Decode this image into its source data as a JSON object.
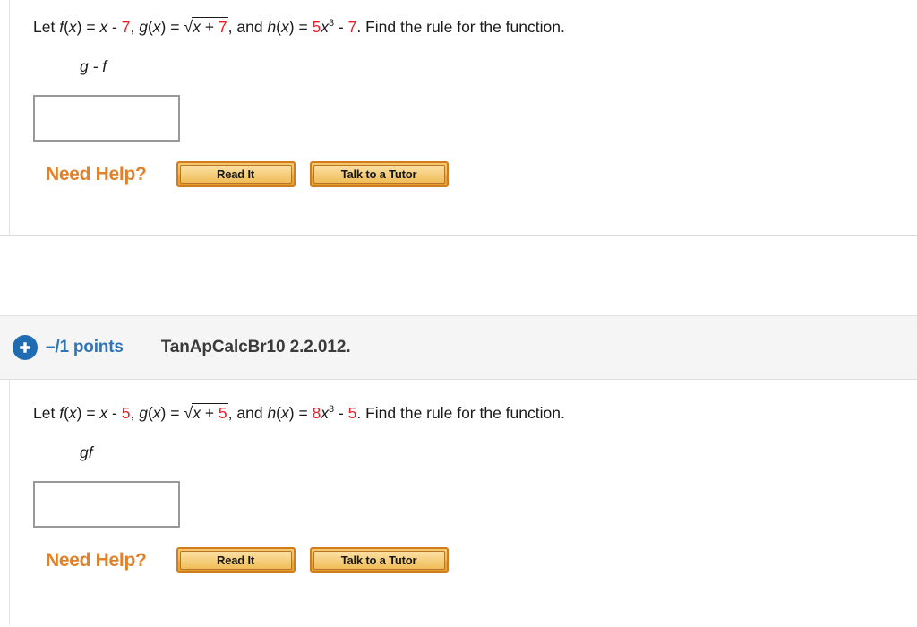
{
  "page": {
    "accent_blue": "#2f74b5",
    "accent_orange": "#e0822c",
    "math_red": "#ee1c25"
  },
  "questions": [
    {
      "header": null,
      "prompt": {
        "let": "Let ",
        "f_name": "f",
        "f_open": "(",
        "f_arg": "x",
        "f_close": ") = ",
        "f_var": "x",
        "f_minus": " - ",
        "f_const": "7",
        "sep1": ", ",
        "g_name": "g",
        "g_open": "(",
        "g_arg": "x",
        "g_close": ") = ",
        "radical": "√",
        "g_radicand_var": "x",
        "g_radicand_plus": " + ",
        "g_radicand_const": "7",
        "sep2": ", and ",
        "h_name": "h",
        "h_open": "(",
        "h_arg": "x",
        "h_close": ") = ",
        "h_coef": "5",
        "h_var": "x",
        "h_exp": "3",
        "h_minus": " - ",
        "h_const": "7",
        "tail": ". Find the rule for the function."
      },
      "rule": "g - f",
      "answer_value": "",
      "need_help": {
        "label": "Need Help?",
        "read_it": "Read It",
        "talk_to_tutor": "Talk to a Tutor"
      }
    },
    {
      "header": {
        "plus_icon": "plus-circle-icon",
        "points": "–/1 points",
        "code": "TanApCalcBr10 2.2.012."
      },
      "prompt": {
        "let": "Let ",
        "f_name": "f",
        "f_open": "(",
        "f_arg": "x",
        "f_close": ") = ",
        "f_var": "x",
        "f_minus": " - ",
        "f_const": "5",
        "sep1": ", ",
        "g_name": "g",
        "g_open": "(",
        "g_arg": "x",
        "g_close": ") = ",
        "radical": "√",
        "g_radicand_var": "x",
        "g_radicand_plus": " + ",
        "g_radicand_const": "5",
        "sep2": ", and ",
        "h_name": "h",
        "h_open": "(",
        "h_arg": "x",
        "h_close": ") = ",
        "h_coef": "8",
        "h_var": "x",
        "h_exp": "3",
        "h_minus": " - ",
        "h_const": "5",
        "tail": ". Find the rule for the function."
      },
      "rule": "gf",
      "answer_value": "",
      "need_help": {
        "label": "Need Help?",
        "read_it": "Read It",
        "talk_to_tutor": "Talk to a Tutor"
      }
    }
  ]
}
